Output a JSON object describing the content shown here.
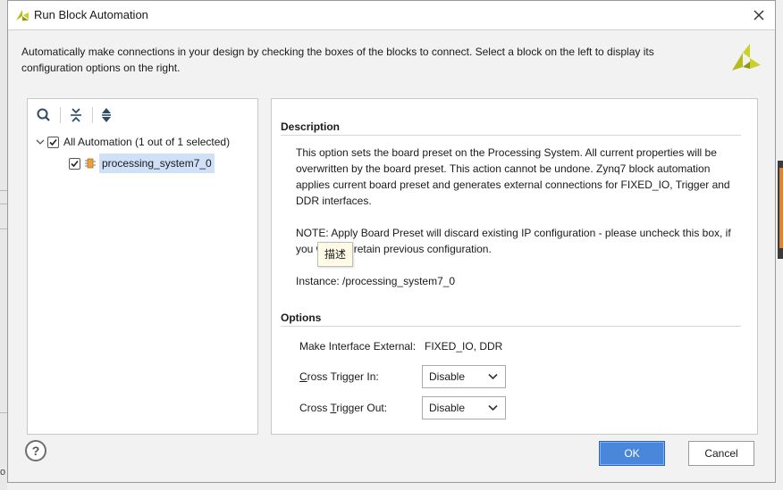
{
  "window": {
    "title": "Run Block Automation",
    "close_glyph": "✕"
  },
  "intro": {
    "text": "Automatically make connections in your design by checking the boxes of the blocks to connect. Select a block on the left to display its configuration options on the right."
  },
  "toolbar": {
    "icons": [
      "search-icon",
      "collapse-all-icon",
      "expand-all-icon"
    ]
  },
  "tree": {
    "root_label": "All Automation (1 out of 1 selected)",
    "root_checked": true,
    "child_label": "processing_system7_0",
    "child_checked": true
  },
  "description": {
    "heading": "Description",
    "para1": "This option sets the board preset on the Processing System. All current properties will be overwritten by the board preset. This action cannot be undone. Zynq7 block automation applies current board preset and generates external connections for FIXED_IO, Trigger and DDR interfaces.",
    "para2": "NOTE: Apply Board Preset will discard existing IP configuration - please uncheck this box, if you want to retain previous configuration.",
    "para3": "Instance: /processing_system7_0"
  },
  "options": {
    "heading": "Options",
    "make_external_label": "Make Interface External:",
    "make_external_value": "FIXED_IO, DDR",
    "cross_in_mnemonic": "C",
    "cross_in_rest": "ross Trigger In:",
    "cross_in_value": "Disable",
    "cross_out_pre": "Cross ",
    "cross_out_mnemonic": "T",
    "cross_out_rest": "rigger Out:",
    "cross_out_value": "Disable"
  },
  "tooltip": {
    "text": "描述"
  },
  "footer": {
    "help_label": "?",
    "ok_label": "OK",
    "cancel_label": "Cancel"
  },
  "background": {
    "bottom_text": "o"
  },
  "colors": {
    "accent": "#4a86d9",
    "selection": "#cfe0f7",
    "xilinx_logo": "#b5bd1c"
  }
}
